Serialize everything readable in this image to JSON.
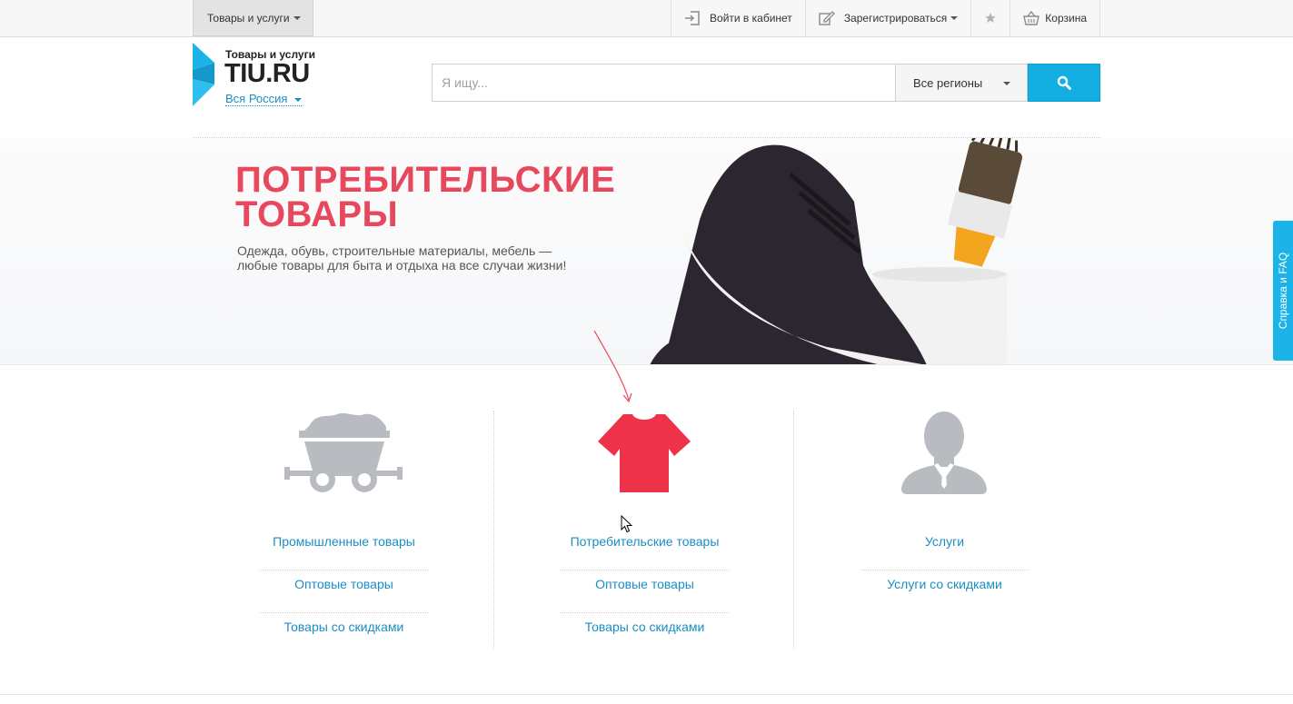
{
  "topbar": {
    "category_label": "Товары и услуги",
    "login_label": "Войти в кабинет",
    "register_label": "Зарегистрироваться",
    "cart_label": "Корзина"
  },
  "logo": {
    "subtitle": "Товары и услуги",
    "name": "TIU.RU",
    "region": "Вся Россия"
  },
  "search": {
    "placeholder": "Я ищу...",
    "region_value": "Все регионы"
  },
  "banner": {
    "title_line1": "ПОТРЕБИТЕЛЬСКИЕ",
    "title_line2": "ТОВАРЫ",
    "text": "Одежда, обувь, строительные материалы, мебель — любые товары для быта и отдыха на все случаи жизни!"
  },
  "help_tab": "Справка и FAQ",
  "categories": [
    {
      "icon": "mine-cart-icon",
      "links": [
        "Промышленные товары",
        "Оптовые товары",
        "Товары со скидками"
      ]
    },
    {
      "icon": "tshirt-icon",
      "links": [
        "Потребительские товары",
        "Оптовые товары",
        "Товары со скидками"
      ]
    },
    {
      "icon": "person-icon",
      "links": [
        "Услуги",
        "Услуги со скидками"
      ]
    }
  ],
  "colors": {
    "accent_blue": "#13afe2",
    "link_blue": "#1a8ec4",
    "banner_red": "#e8485d",
    "tshirt_red": "#ee3249",
    "icon_grey": "#b8bcc1"
  }
}
